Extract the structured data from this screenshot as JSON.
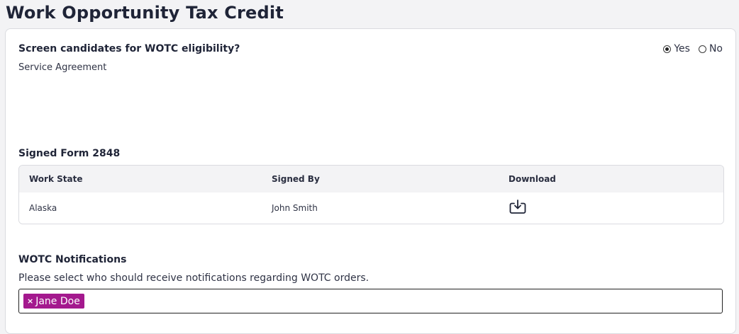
{
  "page": {
    "title": "Work Opportunity Tax Credit"
  },
  "wotc": {
    "question": "Screen candidates for WOTC eligibility?",
    "options": {
      "yes": "Yes",
      "no": "No",
      "selected": "Yes"
    },
    "service_agreement_label": "Service Agreement"
  },
  "form2848": {
    "heading": "Signed Form 2848",
    "columns": [
      "Work State",
      "Signed By",
      "Download"
    ],
    "rows": [
      {
        "work_state": "Alaska",
        "signed_by": "John Smith",
        "download_icon": "download-tray-icon"
      }
    ]
  },
  "notifications": {
    "heading": "WOTC Notifications",
    "description": "Please select who should receive notifications regarding WOTC orders.",
    "selected_recipients": [
      {
        "name": "Jane Doe",
        "remove_glyph": "×"
      }
    ],
    "tag_color": "#a4198e"
  }
}
